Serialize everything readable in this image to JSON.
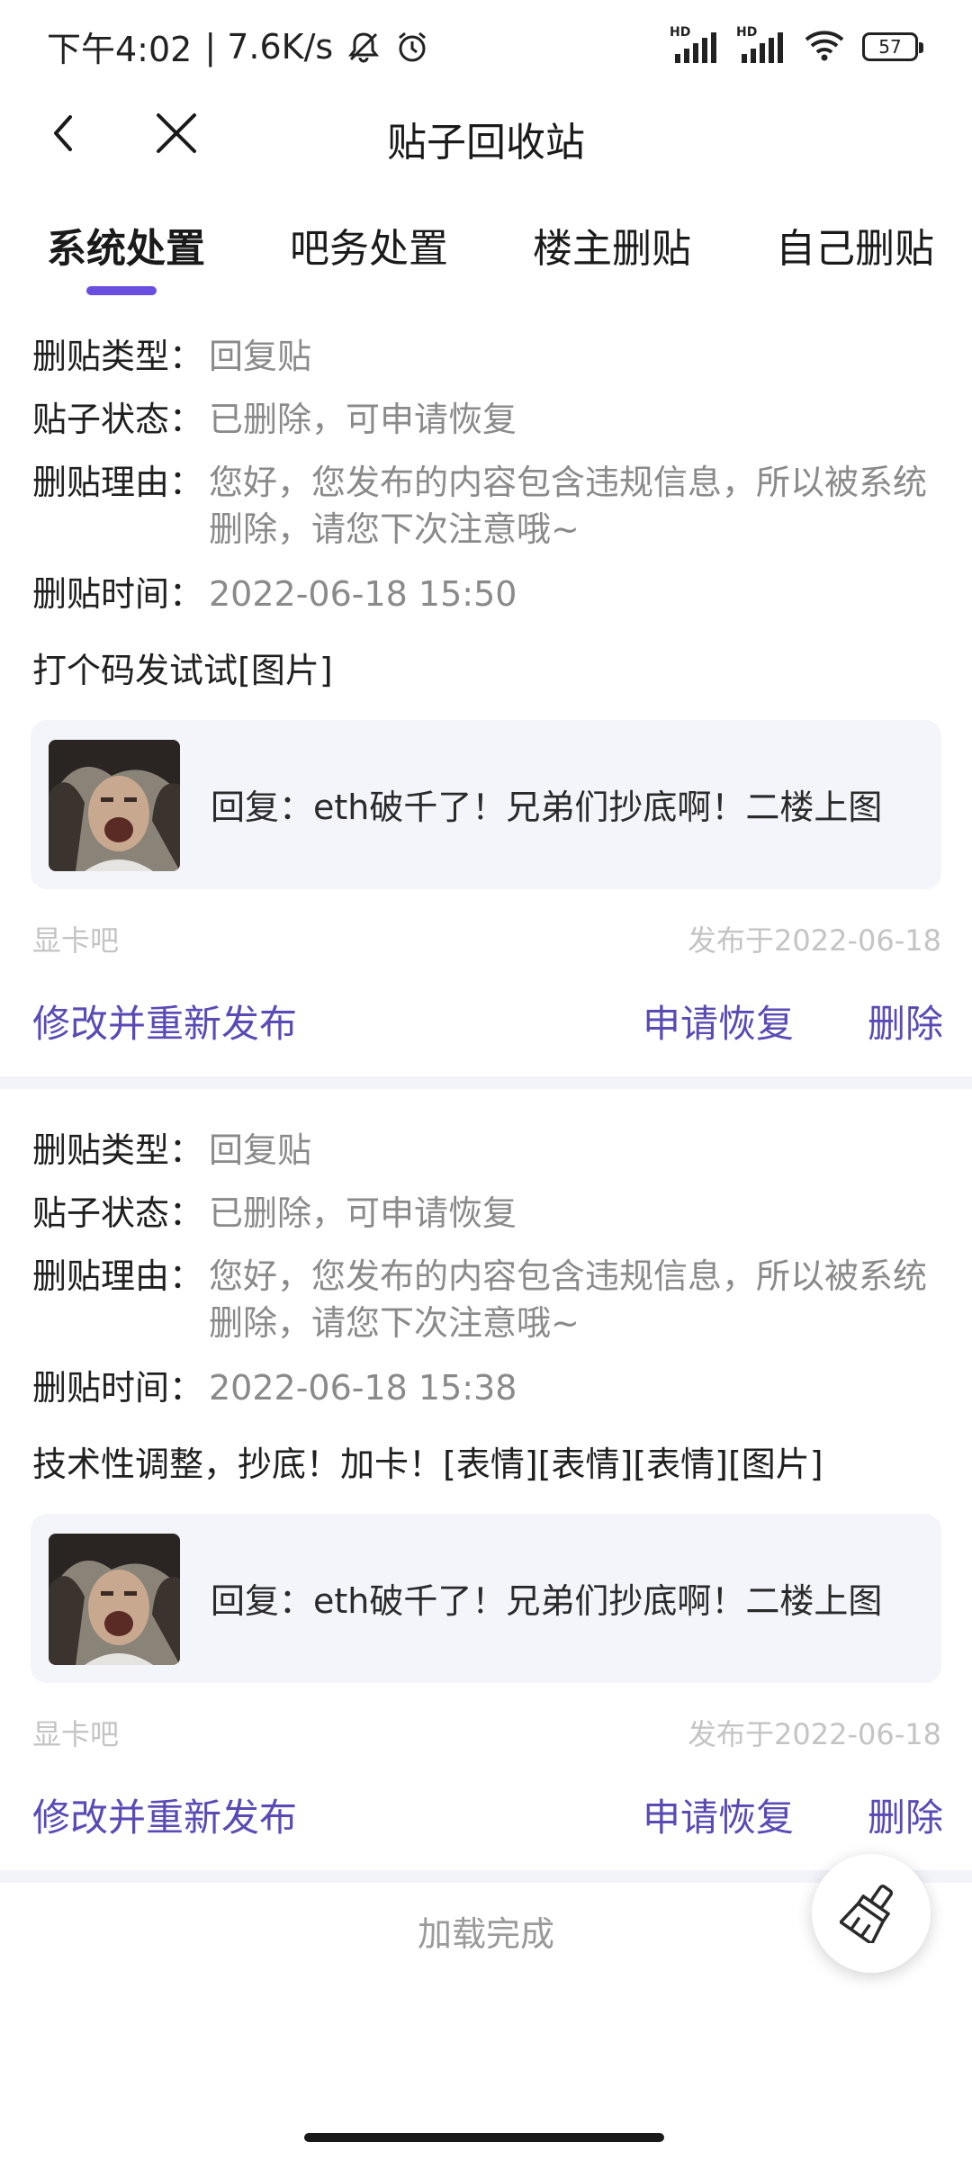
{
  "status_bar": {
    "time": "下午4:02",
    "net_speed": "| 7.6K/s",
    "hd1": "HD",
    "hd2": "HD",
    "battery": "57"
  },
  "header": {
    "title": "贴子回收站"
  },
  "tabs": [
    {
      "label": "系统处置",
      "active": true
    },
    {
      "label": "吧务处置",
      "active": false
    },
    {
      "label": "楼主删贴",
      "active": false
    },
    {
      "label": "自己删贴",
      "active": false
    }
  ],
  "labels": {
    "type": "删贴类型：",
    "status": "贴子状态：",
    "reason": "删贴理由：",
    "time": "删贴时间："
  },
  "posts": [
    {
      "type": "回复贴",
      "status": "已删除，可申请恢复",
      "reason": "您好，您发布的内容包含违规信息，所以被系统删除，请您下次注意哦~",
      "time": "2022-06-18 15:50",
      "content": "打个码发试试[图片]",
      "quote": "回复：eth破千了！兄弟们抄底啊！二楼上图",
      "forum": "显卡吧",
      "published": "发布于2022-06-18",
      "actions": {
        "edit": "修改并重新发布",
        "restore": "申请恢复",
        "delete": "删除"
      }
    },
    {
      "type": "回复贴",
      "status": "已删除，可申请恢复",
      "reason": "您好，您发布的内容包含违规信息，所以被系统删除，请您下次注意哦~",
      "time": "2022-06-18 15:38",
      "content": "技术性调整，抄底！加卡！[表情][表情][表情][图片]",
      "quote": "回复：eth破千了！兄弟们抄底啊！二楼上图",
      "forum": "显卡吧",
      "published": "发布于2022-06-18",
      "actions": {
        "edit": "修改并重新发布",
        "restore": "申请恢复",
        "delete": "删除"
      }
    }
  ],
  "footer": {
    "loaded": "加载完成"
  },
  "colors": {
    "accent": "#6a4ee0",
    "action": "#5a4ab5",
    "muted": "#8a8a8a",
    "quote_bg": "#f4f4fb"
  },
  "icons": [
    "bell-off-icon",
    "alarm-icon",
    "signal-icon",
    "wifi-icon",
    "battery-icon",
    "back-arrow-icon",
    "close-icon",
    "broom-icon"
  ]
}
